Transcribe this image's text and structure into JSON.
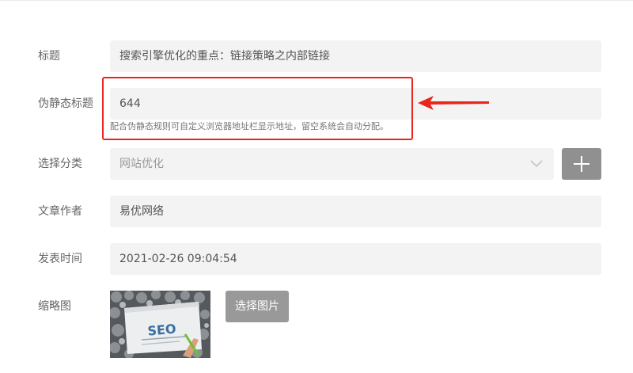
{
  "form": {
    "title": {
      "label": "标题",
      "value": "搜索引擎优化的重点：链接策略之内部链接"
    },
    "slug": {
      "label": "伪静态标题",
      "value": "644",
      "hint": "配合伪静态规则可自定义浏览器地址栏显示地址，留空系统会自动分配。"
    },
    "category": {
      "label": "选择分类",
      "selected": "网站优化",
      "add_icon": "plus-icon"
    },
    "author": {
      "label": "文章作者",
      "value": "易优网络"
    },
    "publish_time": {
      "label": "发表时间",
      "value": "2021-02-26 09:04:54"
    },
    "thumbnail": {
      "label": "缩略图",
      "button_label": "选择图片",
      "image_text": "SEO"
    }
  },
  "annotation": {
    "color": "#e8261e",
    "arrow_icon": "arrow-left-icon"
  }
}
